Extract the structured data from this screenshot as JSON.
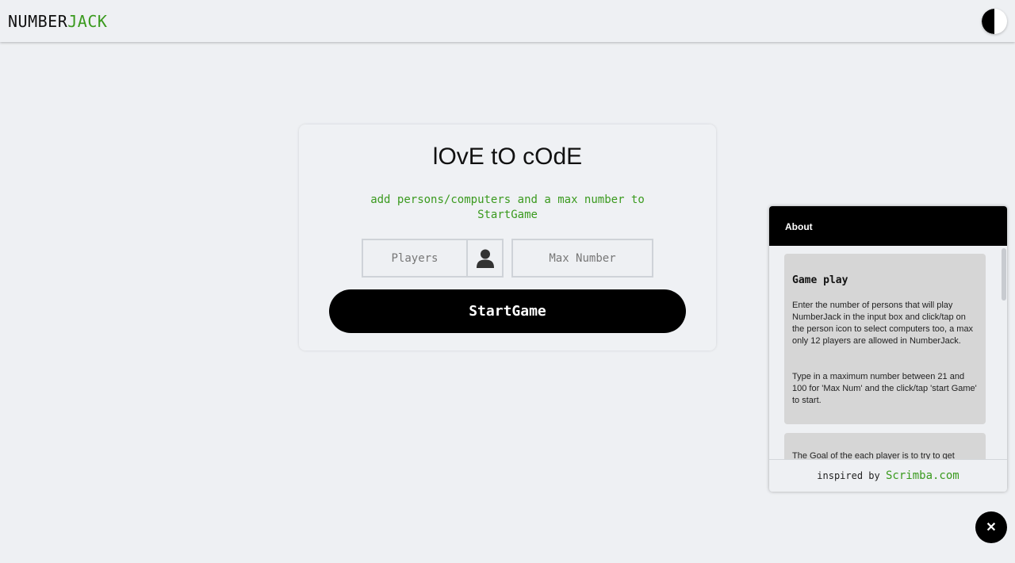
{
  "header": {
    "logo_part1": "NUMBER",
    "logo_part2": "JACK",
    "accent_color": "#3a9a1e",
    "theme_toggle_icon": "half-moon-icon"
  },
  "card": {
    "title": "lOvE tO cOdE",
    "subtitle": "add persons/computers and a max number to StartGame",
    "players_placeholder": "Players",
    "person_icon": "person-icon",
    "max_placeholder": "Max Number",
    "start_label": "StartGame"
  },
  "about": {
    "header": "About",
    "panels": [
      {
        "title": "Game play",
        "text1": "Enter the number of persons that will play NumberJack in the input box and click/tap on the person icon to select computers too, a max only 12 players are allowed in NumberJack.",
        "text2": "Type in a maximum number between 21 and 100 for 'Max Num' and the click/tap 'start Game' to start."
      },
      {
        "text": "The Goal of the each player is to try to get"
      }
    ],
    "footer_text": "inspired by",
    "footer_link": "Scrimba.com"
  },
  "close_label": "✕"
}
